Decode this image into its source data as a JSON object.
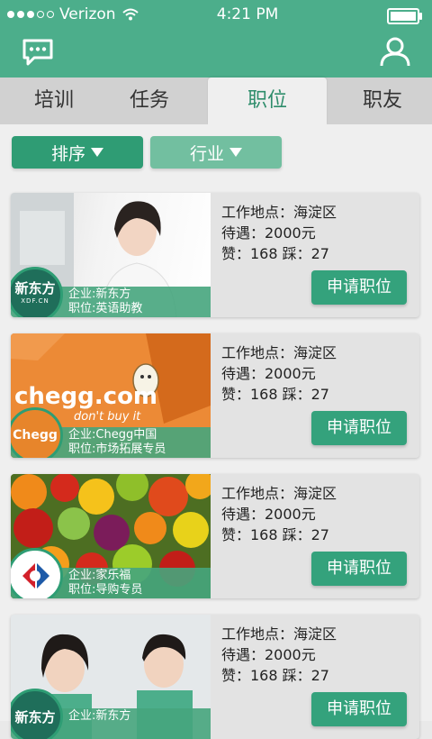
{
  "status_bar": {
    "carrier": "Verizon",
    "time": "4:21 PM"
  },
  "header": {
    "left_icon": "chat-icon",
    "right_icon": "user-icon"
  },
  "tabs": [
    {
      "label": "培训"
    },
    {
      "label": "任务"
    },
    {
      "label": "职位"
    },
    {
      "label": "职友"
    }
  ],
  "filters": [
    {
      "label": "排序"
    },
    {
      "label": "行业"
    }
  ],
  "cards": [
    {
      "company": "企业:新东方",
      "position": "职位:英语助教",
      "location": "工作地点：海淀区",
      "salary": "待遇：2000元",
      "votes": "赞：168  踩：27",
      "apply": "申请职位",
      "logo_text": "新东方",
      "logo_sub": "XDF.CN"
    },
    {
      "company": "企业:Chegg中国",
      "position": "职位:市场拓展专员",
      "location": "工作地点：海淀区",
      "salary": "待遇：2000元",
      "votes": "赞：168  踩：27",
      "apply": "申请职位",
      "logo_text": "Chegg",
      "photo_text": "chegg.com",
      "photo_sub": "don't buy it"
    },
    {
      "company": "企业:家乐福",
      "position": "职位:导购专员",
      "location": "工作地点：海淀区",
      "salary": "待遇：2000元",
      "votes": "赞：168  踩：27",
      "apply": "申请职位"
    },
    {
      "company": "企业:新东方",
      "position": "",
      "location": "工作地点：海淀区",
      "salary": "待遇：2000元",
      "votes": "赞：168  踩：27",
      "apply": "申请职位",
      "logo_text": "新东方"
    }
  ],
  "colors": {
    "primary": "#4cae8b",
    "button": "#34a27c",
    "accent_text": "#2e8d6b"
  }
}
